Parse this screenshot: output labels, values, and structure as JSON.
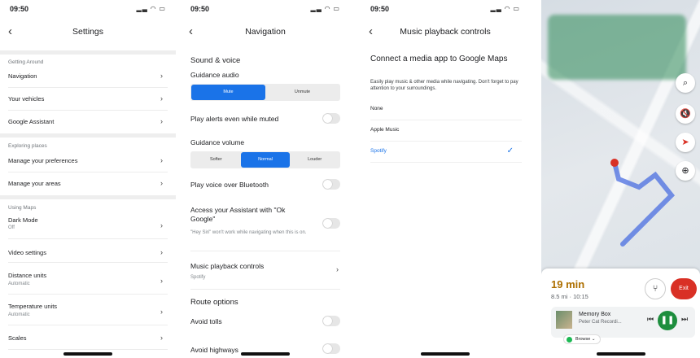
{
  "status": {
    "time": "09:50",
    "location_icon": "location-arrow-icon",
    "system_icons": "signal wifi battery"
  },
  "settings": {
    "title": "Settings",
    "sections": [
      {
        "header": "Getting Around",
        "items": [
          {
            "label": "Navigation"
          },
          {
            "label": "Your vehicles"
          },
          {
            "label": "Google Assistant"
          }
        ]
      },
      {
        "header": "Exploring places",
        "items": [
          {
            "label": "Manage your preferences"
          },
          {
            "label": "Manage your areas"
          }
        ]
      },
      {
        "header": "Using Maps",
        "items": [
          {
            "label": "Dark Mode",
            "value": "Off"
          },
          {
            "label": "Video settings"
          },
          {
            "label": "Distance units",
            "value": "Automatic"
          },
          {
            "label": "Temperature units",
            "value": "Automatic"
          },
          {
            "label": "Scales"
          }
        ]
      }
    ]
  },
  "navigation": {
    "title": "Navigation",
    "sound_voice": "Sound & voice",
    "guidance_audio": "Guidance audio",
    "audio_options": [
      "Mute",
      "Unmute"
    ],
    "play_alerts": "Play alerts even while muted",
    "guidance_volume": "Guidance volume",
    "volume_options": [
      "Softer",
      "Normal",
      "Louder"
    ],
    "play_bluetooth": "Play voice over Bluetooth",
    "assistant_title": "Access your Assistant with \"Ok Google\"",
    "assistant_note": "\"Hey Siri\" won't work while navigating when this is on.",
    "music_controls": "Music playback controls",
    "music_value": "Spotify",
    "route_options": "Route options",
    "avoid_tolls": "Avoid tolls",
    "avoid_highways": "Avoid highways"
  },
  "music": {
    "title": "Music playback controls",
    "heading": "Connect a media app to Google Maps",
    "description": "Easily play music & other media while navigating. Don't forget to pay attention to your surroundings.",
    "options": [
      "None",
      "Apple Music",
      "Spotify"
    ],
    "selected": "Spotify"
  },
  "map": {
    "eta": "19 min",
    "distance_time": "8.5 mi · 10:15",
    "exit": "Exit",
    "track": "Memory Box",
    "artist": "Peter Cat Recordi...",
    "browse": "Browse",
    "colors": {
      "accent": "#1a73e8",
      "exit": "#d93025",
      "play": "#1e8e3e",
      "eta": "#ad6f00"
    }
  }
}
